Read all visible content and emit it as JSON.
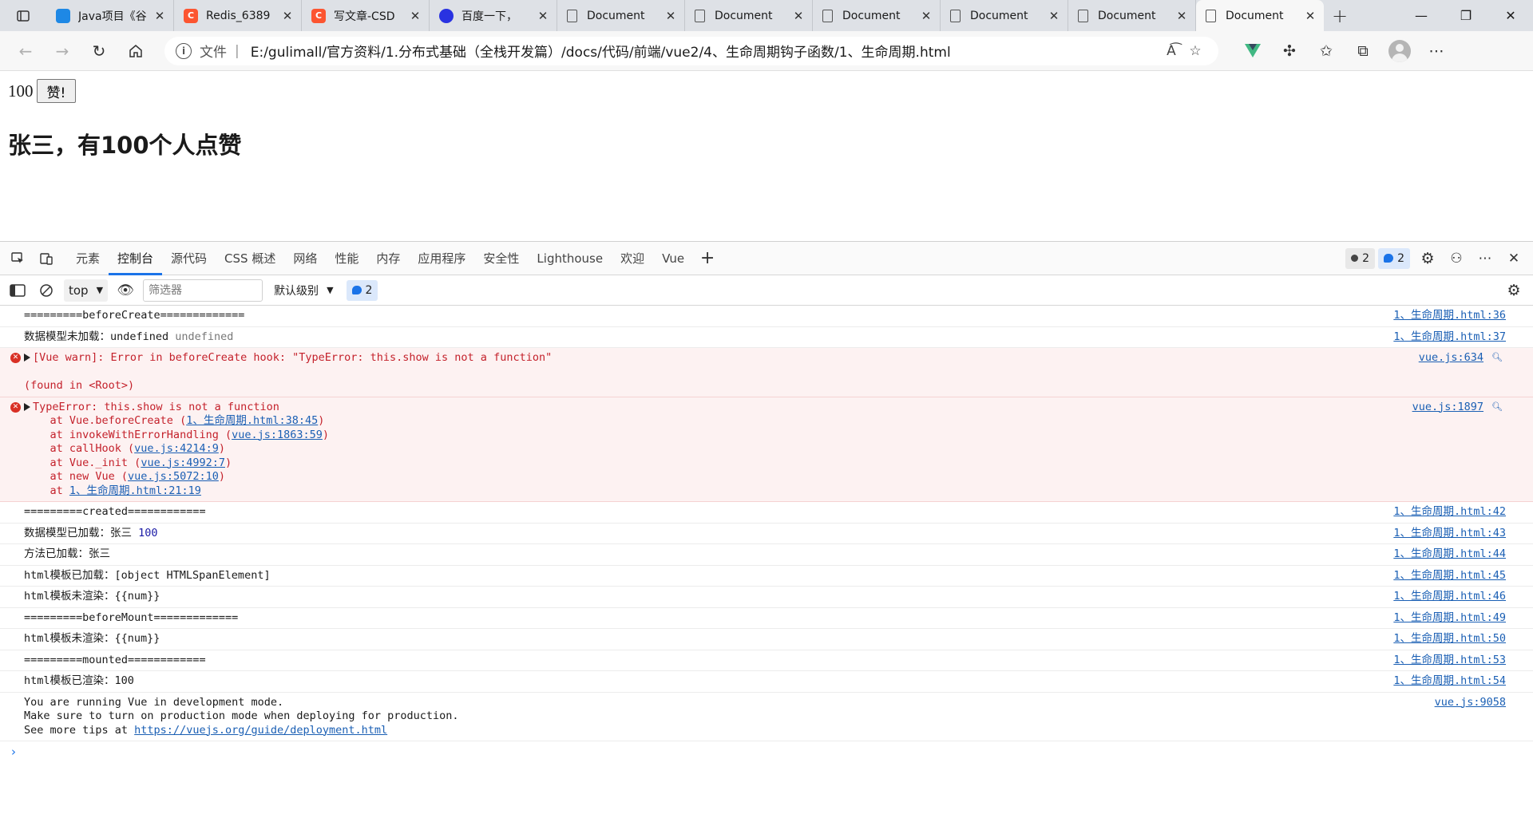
{
  "browser": {
    "tabs": [
      {
        "title": "Java项目《谷",
        "fav": "java"
      },
      {
        "title": "Redis_6389",
        "fav": "csdn"
      },
      {
        "title": "写文章-CSD",
        "fav": "csdn"
      },
      {
        "title": "百度一下，",
        "fav": "baidu"
      },
      {
        "title": "Document",
        "fav": "doc"
      },
      {
        "title": "Document",
        "fav": "doc"
      },
      {
        "title": "Document",
        "fav": "doc"
      },
      {
        "title": "Document",
        "fav": "doc"
      },
      {
        "title": "Document",
        "fav": "doc"
      },
      {
        "title": "Document",
        "fav": "doc",
        "active": true
      }
    ],
    "address": {
      "scheme_label": "文件",
      "url": "E:/gulimall/官方资料/1.分布式基础（全栈开发篇）/docs/代码/前端/vue2/4、生命周期钩子函数/1、生命周期.html"
    }
  },
  "page": {
    "count": "100",
    "button_label": "赞!",
    "heading": "张三，有100个人点赞"
  },
  "devtools": {
    "tabs": [
      "元素",
      "控制台",
      "源代码",
      "CSS 概述",
      "网络",
      "性能",
      "内存",
      "应用程序",
      "安全性",
      "Lighthouse",
      "欢迎",
      "Vue"
    ],
    "active_tab_index": 1,
    "issue_badges": {
      "errors": "2",
      "messages": "2"
    },
    "console_bar": {
      "context": "top",
      "filter_placeholder": "筛选器",
      "level": "默认级别",
      "message_count": "2"
    },
    "console_rows": [
      {
        "type": "log",
        "text": "=========beforeCreate=============",
        "src": "1、生命周期.html:36"
      },
      {
        "type": "log",
        "text": "数据模型未加载：undefined ",
        "extra": "undefined",
        "extra_class": "val-undef",
        "src": "1、生命周期.html:37"
      },
      {
        "type": "error",
        "text": "[Vue warn]: Error in beforeCreate hook: \"TypeError: this.show is not a function\"\n\n(found in <Root>)",
        "src": "vue.js:634"
      },
      {
        "type": "error_stack",
        "head": "TypeError: this.show is not a function",
        "stack": [
          {
            "prefix": "    at Vue.beforeCreate (",
            "link": "1、生命周期.html:38:45",
            "suffix": ")"
          },
          {
            "prefix": "    at invokeWithErrorHandling (",
            "link": "vue.js:1863:59",
            "suffix": ")"
          },
          {
            "prefix": "    at callHook (",
            "link": "vue.js:4214:9",
            "suffix": ")"
          },
          {
            "prefix": "    at Vue._init (",
            "link": "vue.js:4992:7",
            "suffix": ")"
          },
          {
            "prefix": "    at new Vue (",
            "link": "vue.js:5072:10",
            "suffix": ")"
          },
          {
            "prefix": "    at ",
            "link": "1、生命周期.html:21:19",
            "suffix": ""
          }
        ],
        "src": "vue.js:1897"
      },
      {
        "type": "log",
        "text": "=========created============",
        "src": "1、生命周期.html:42"
      },
      {
        "type": "log",
        "text": "数据模型已加载：张三 ",
        "extra": "100",
        "extra_class": "val-num",
        "src": "1、生命周期.html:43"
      },
      {
        "type": "log",
        "text": "方法已加载：张三",
        "src": "1、生命周期.html:44"
      },
      {
        "type": "log",
        "text": "html模板已加载：[object HTMLSpanElement]",
        "src": "1、生命周期.html:45"
      },
      {
        "type": "log",
        "text": "html模板未渲染：{{num}}",
        "src": "1、生命周期.html:46"
      },
      {
        "type": "log",
        "text": "=========beforeMount=============",
        "src": "1、生命周期.html:49"
      },
      {
        "type": "log",
        "text": "html模板未渲染：{{num}}",
        "src": "1、生命周期.html:50"
      },
      {
        "type": "log",
        "text": "=========mounted============",
        "src": "1、生命周期.html:53"
      },
      {
        "type": "log",
        "text": "html模板已渲染：100",
        "src": "1、生命周期.html:54"
      },
      {
        "type": "log_link",
        "text": "You are running Vue in development mode.\nMake sure to turn on production mode when deploying for production.\nSee more tips at ",
        "link": "https://vuejs.org/guide/deployment.html",
        "src": "vue.js:9058"
      }
    ]
  }
}
